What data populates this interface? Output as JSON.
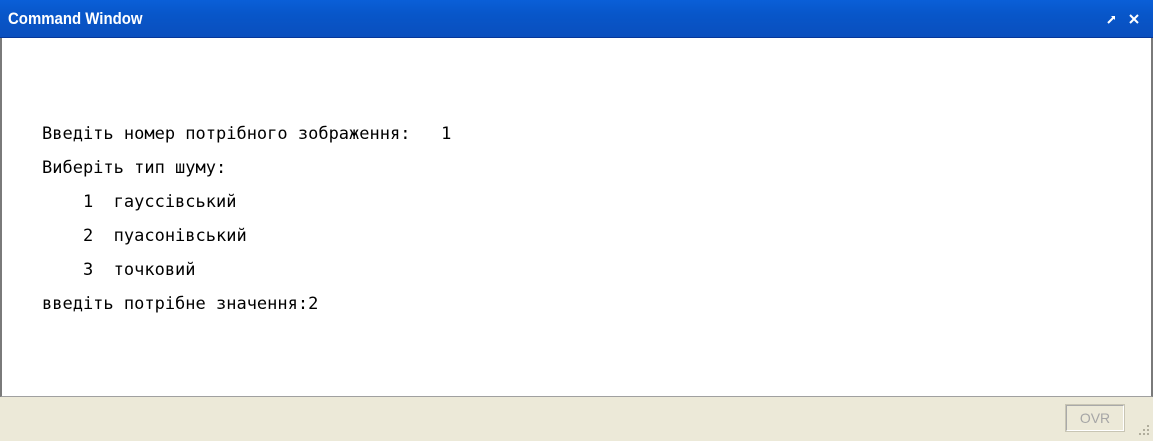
{
  "window": {
    "title": "Command Window",
    "undock_icon": "undock-arrow-icon",
    "close_icon": "close-icon"
  },
  "console": {
    "lines": [
      "Введіть номер потрібного зображення:   1",
      "Виберіть тип шуму:",
      "    1  гауссівський",
      "    2  пуасонівський",
      "    3  точковий",
      "введіть потрібне значення:2"
    ]
  },
  "statusbar": {
    "ovr_label": "OVR",
    "grip_icon": "resize-grip-icon"
  },
  "colors": {
    "titlebar": "#0a5fd8",
    "title_text": "#ffffff",
    "console_bg": "#ffffff",
    "chrome_bg": "#ece9d8",
    "ovr_text": "#a6a6a6"
  }
}
